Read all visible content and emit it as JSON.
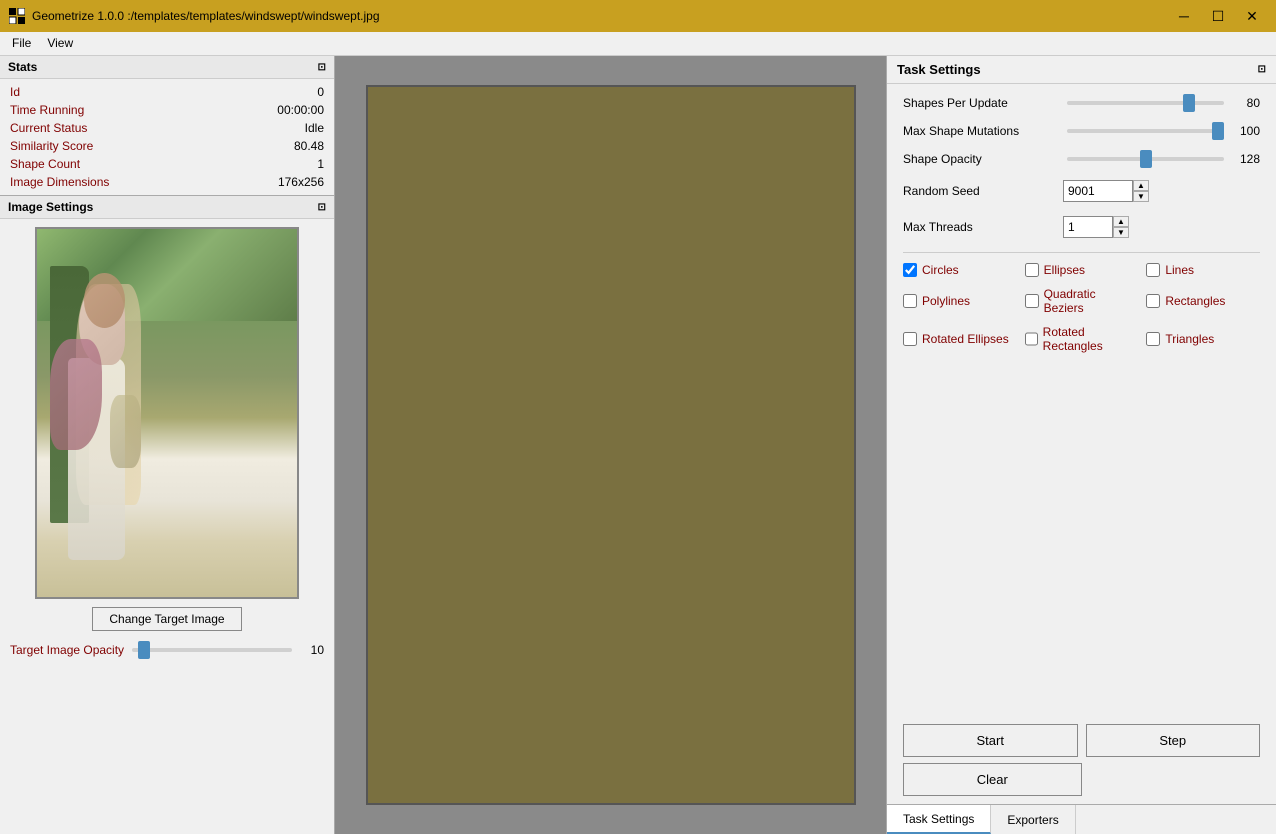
{
  "titleBar": {
    "appTitle": "Geometrize 1.0.0 :/templates/templates/windswept/windswept.jpg",
    "minimizeLabel": "─",
    "maximizeLabel": "☐",
    "closeLabel": "✕"
  },
  "menuBar": {
    "items": [
      "File",
      "View"
    ]
  },
  "statsPanel": {
    "title": "Stats",
    "rows": [
      {
        "label": "Id",
        "value": "0"
      },
      {
        "label": "Time Running",
        "value": "00:00:00"
      },
      {
        "label": "Current Status",
        "value": "Idle"
      },
      {
        "label": "Similarity Score",
        "value": "80.48"
      },
      {
        "label": "Shape Count",
        "value": "1"
      },
      {
        "label": "Image Dimensions",
        "value": "176x256"
      }
    ]
  },
  "imageSettingsPanel": {
    "title": "Image Settings",
    "changeTargetLabel": "Change Target Image",
    "opacityLabel": "Target Image Opacity",
    "opacityValue": "10",
    "opacityMin": 0,
    "opacityMax": 255,
    "opacityCurrent": 10
  },
  "taskSettings": {
    "title": "Task Settings",
    "shapesPerUpdate": {
      "label": "Shapes Per Update",
      "value": 80,
      "min": 1,
      "max": 100,
      "current": 80
    },
    "maxShapeMutations": {
      "label": "Max Shape Mutations",
      "value": 100,
      "min": 1,
      "max": 100,
      "current": 100
    },
    "shapeOpacity": {
      "label": "Shape Opacity",
      "value": 128,
      "min": 0,
      "max": 255,
      "current": 128
    },
    "randomSeed": {
      "label": "Random Seed",
      "value": "9001"
    },
    "maxThreads": {
      "label": "Max Threads",
      "value": "1"
    },
    "checkboxes": [
      {
        "label": "Circles",
        "checked": true,
        "id": "cb-circles"
      },
      {
        "label": "Ellipses",
        "checked": false,
        "id": "cb-ellipses"
      },
      {
        "label": "Lines",
        "checked": false,
        "id": "cb-lines"
      },
      {
        "label": "Polylines",
        "checked": false,
        "id": "cb-polylines"
      },
      {
        "label": "Quadratic Beziers",
        "checked": false,
        "id": "cb-quadbez"
      },
      {
        "label": "Rectangles",
        "checked": false,
        "id": "cb-rects"
      },
      {
        "label": "Rotated Ellipses",
        "checked": false,
        "id": "cb-rotellipses"
      },
      {
        "label": "Rotated Rectangles",
        "checked": false,
        "id": "cb-rotrects"
      },
      {
        "label": "Triangles",
        "checked": false,
        "id": "cb-triangles"
      }
    ],
    "startLabel": "Start",
    "stepLabel": "Step",
    "clearLabel": "Clear"
  },
  "bottomTabs": {
    "items": [
      "Task Settings",
      "Exporters"
    ],
    "activeIndex": 0
  }
}
